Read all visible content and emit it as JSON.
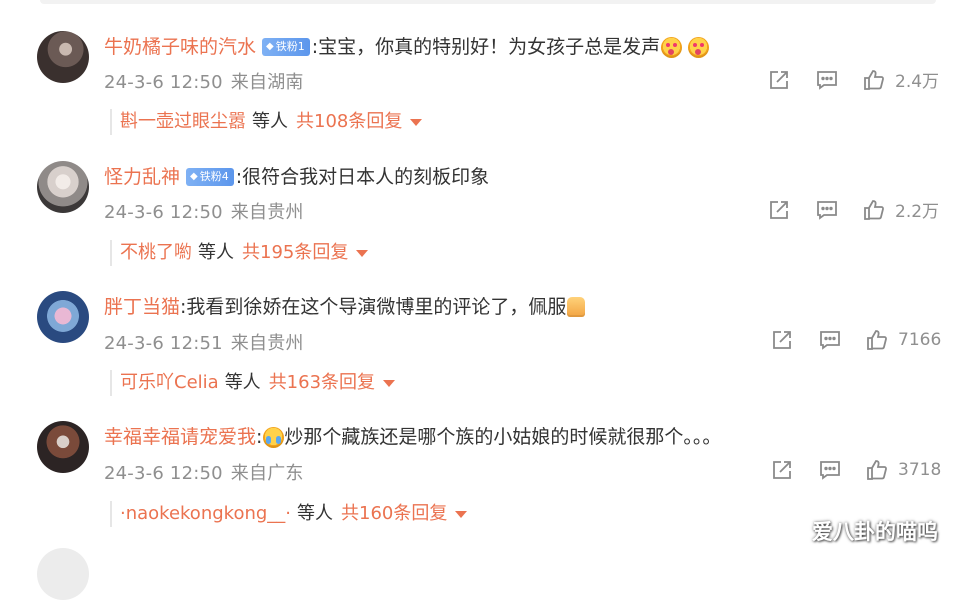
{
  "comments": [
    {
      "username": "牛奶橘子味的汽水",
      "fan_badge": "铁粉1",
      "text": ":宝宝，你真的特别好！为女孩子总是发声",
      "emojis": [
        "love-face-emoji",
        "love-face-emoji"
      ],
      "time": "24-3-6 12:50",
      "location": "来自湖南",
      "likes": "2.4万",
      "reply_name": "斟一壶过眼尘嚣",
      "reply_mid": "等人",
      "reply_total": "共108条回复"
    },
    {
      "username": "怪力乱神",
      "fan_badge": "铁粉4",
      "text": ":很符合我对日本人的刻板印象",
      "emojis": [],
      "time": "24-3-6 12:50",
      "location": "来自贵州",
      "likes": "2.2万",
      "reply_name": "不桃了喲",
      "reply_mid": "等人",
      "reply_total": "共195条回复"
    },
    {
      "username": "胖丁当猫",
      "fan_badge": "",
      "text": ":我看到徐娇在这个导演微博里的评论了，佩服",
      "emojis": [
        "thumbs-up-emoji"
      ],
      "time": "24-3-6 12:51",
      "location": "来自贵州",
      "likes": "7166",
      "reply_name": "可乐吖Celia",
      "reply_mid": "等人",
      "reply_total": "共163条回复"
    },
    {
      "username": "幸福幸福请宠爱我",
      "fan_badge": "",
      "text": "炒那个藏族还是哪个族的小姑娘的时候就很那个。。。",
      "prefix": ":",
      "emojis": [
        "crying-face-emoji"
      ],
      "time": "24-3-6 12:50",
      "location": "来自广东",
      "likes": "3718",
      "reply_name": "·naokekongkong__·",
      "reply_mid": "等人",
      "reply_total": "共160条回复"
    }
  ],
  "watermark": "爱八卦的喵呜",
  "colors": {
    "username": "#eb7350",
    "meta": "#8f8f8f",
    "badge": "#6aa3f0"
  },
  "icons": [
    "share-icon",
    "comment-icon",
    "like-icon"
  ]
}
